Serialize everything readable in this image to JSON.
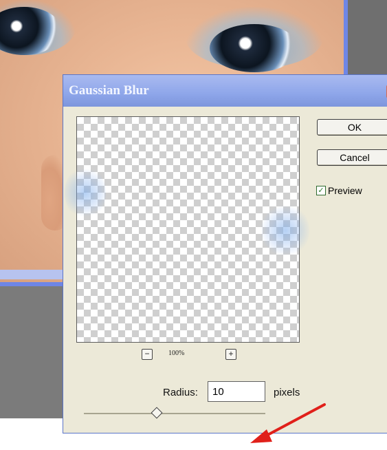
{
  "dialog": {
    "title": "Gaussian Blur",
    "ok_label": "OK",
    "cancel_label": "Cancel",
    "preview_label": "Preview",
    "preview_checked": true,
    "zoom_level": "100%",
    "zoom_out_symbol": "−",
    "zoom_in_symbol": "+",
    "radius_label": "Radius:",
    "radius_value": "10",
    "radius_unit": "pixels"
  },
  "colors": {
    "title_bar": "#8ea6ea",
    "dialog_bg": "#ece9d8",
    "annotation_arrow": "#e0201a",
    "window_border": "#6e86e6"
  },
  "icons": {
    "checkbox": "check-icon",
    "close": "close-icon",
    "annotation": "red-arrow-icon"
  }
}
